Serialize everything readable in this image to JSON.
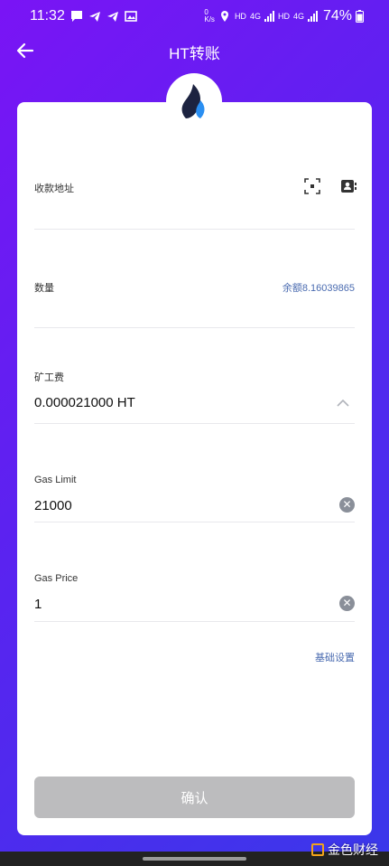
{
  "status_bar": {
    "time": "11:32",
    "net_speed": "0\nK/s",
    "hd1": "HD",
    "lte1": "4G",
    "hd2": "HD",
    "lte2": "4G",
    "battery": "74%"
  },
  "header": {
    "title": "HT转账"
  },
  "form": {
    "address_label": "收款地址",
    "amount_label": "数量",
    "balance_link": "余额8.16039865",
    "fee_label": "矿工费",
    "fee_value": "0.000021000 HT",
    "gas_limit_label": "Gas Limit",
    "gas_limit_value": "21000",
    "gas_price_label": "Gas Price",
    "gas_price_value": "1",
    "basic_settings_link": "基础设置",
    "confirm_label": "确认"
  },
  "watermark": {
    "text": "金色财经"
  },
  "colors": {
    "gradient_start": "#7a14f5",
    "gradient_end": "#3a38ea",
    "link": "#4a6bb0",
    "confirm_disabled": "#bcbcbe"
  }
}
